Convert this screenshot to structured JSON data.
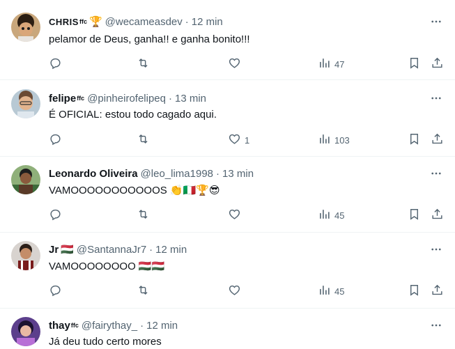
{
  "tweets": [
    {
      "name": "CHRIS",
      "badge": "ffc",
      "name_emoji": "🏆",
      "handle": "@wecameasdev",
      "time": "12 min",
      "text": "pelamor de Deus, ganha!! e ganha bonito!!!",
      "likes": "",
      "views": "47"
    },
    {
      "name": "felipe",
      "badge": "ffc",
      "name_emoji": "",
      "handle": "@pinheirofelipeq",
      "time": "13 min",
      "text": "É OFICIAL: estou todo cagado aqui.",
      "likes": "1",
      "views": "103"
    },
    {
      "name": "Leonardo Oliveira",
      "badge": "",
      "name_emoji": "",
      "handle": "@leo_lima1998",
      "time": "13 min",
      "text": "VAMOOOOOOOOOOOS",
      "text_emoji": "👏🇮🇹🏆😎",
      "likes": "",
      "views": "45"
    },
    {
      "name": "Jr",
      "badge": "",
      "name_emoji": "🇭🇺",
      "handle": "@SantannaJr7",
      "time": "12 min",
      "text": "VAMOOOOOOOO",
      "text_emoji": "🇭🇺🇭🇺",
      "likes": "",
      "views": "45"
    },
    {
      "name": "thay",
      "badge": "ffc",
      "name_emoji": "",
      "handle": "@fairythay_",
      "time": "12 min",
      "text": "Já deu tudo certo mores",
      "likes": "",
      "views": ""
    }
  ],
  "icons": {
    "reply": "reply-icon",
    "retweet": "retweet-icon",
    "like": "heart-icon",
    "views": "views-icon",
    "bookmark": "bookmark-icon",
    "share": "share-icon",
    "more": "more-icon"
  },
  "colors": {
    "text": "#0f1419",
    "secondary": "#536471",
    "divider": "#eff3f4"
  }
}
